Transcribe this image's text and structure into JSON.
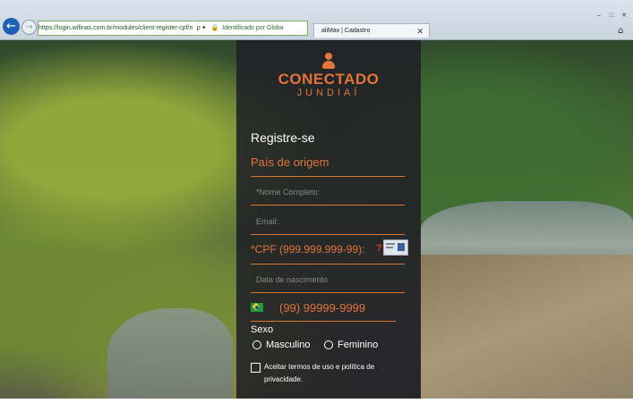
{
  "browser": {
    "url": "https://login.wifinas.com.br/modules/client-register-cpf/n",
    "address_controls": "ρ ▾",
    "identified_by": "Identificado por Globa",
    "tab_title": "aliMax | Cadastro",
    "tab_close": "✕",
    "back_symbol": "←",
    "forward_symbol": "→",
    "lock_symbol": "🔒",
    "minimize": "–",
    "maximize": "□",
    "close": "✕",
    "home_symbol": "⌂"
  },
  "form": {
    "logo_main": "CONECTADO",
    "logo_sub": "JUNDIAÍ",
    "title": "Registre-se",
    "country_label": "País de origem",
    "full_name_placeholder": "*Nome Completo:",
    "email_placeholder": "Email:",
    "cpf_label": "*CPF (999.999.999-99):",
    "cpf_help": "?",
    "birthdate_placeholder": "Data de nascimento",
    "phone_placeholder": "(99) 99999-9999",
    "sex_label": "Sexo",
    "male_option": "Masculino",
    "female_option": "Feminino",
    "terms_text": "Aceitar termos de uso e política de privacidade."
  },
  "colors": {
    "accent": "#e4743a",
    "panel": "#202026"
  }
}
